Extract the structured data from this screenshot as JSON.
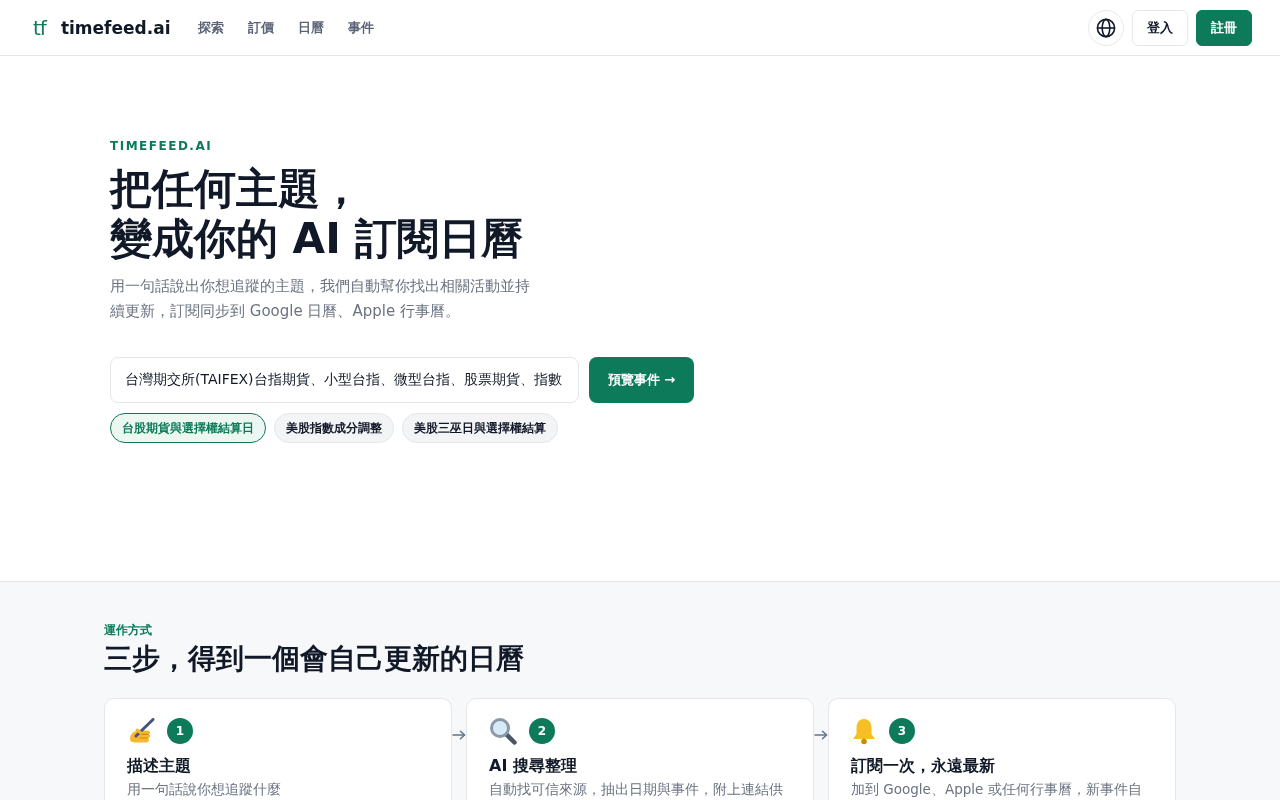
{
  "nav": {
    "logo_mark": "tf",
    "brand": "timefeed.ai",
    "links": [
      {
        "label": "探索"
      },
      {
        "label": "訂價"
      },
      {
        "label": "日曆"
      },
      {
        "label": "事件"
      }
    ],
    "login": "登入",
    "signup": "註冊"
  },
  "hero": {
    "eyebrow": "TIMEFEED.AI",
    "headline_lines": [
      "把任何主題，",
      "變成你的 AI 訂閱日曆"
    ],
    "subtitle": "用一句話說出你想追蹤的主題，我們自動幫你找出相關活動並持續更新，訂閱同步到 Google 日曆、Apple 行事曆。",
    "search": {
      "value": "台灣期交所(TAIFEX)台指期貨、小型台指、微型台指、股票期貨、指數"
    },
    "preview_button": "預覽事件 →",
    "chips": [
      {
        "label": "台股期貨與選擇權結算日",
        "selected": true
      },
      {
        "label": "美股指數成分調整",
        "selected": false
      },
      {
        "label": "美股三巫日與選擇權結算",
        "selected": false
      }
    ]
  },
  "how_it_works": {
    "eyebrow": "運作方式",
    "title": "三步，得到一個會自己更新的日曆",
    "steps": [
      {
        "number": "1",
        "title": "描述主題",
        "description": "用一句話說你想追蹤什麼"
      },
      {
        "number": "2",
        "title": "AI 搜尋整理",
        "description": "自動找可信來源，抽出日期與事件，附上連結供"
      },
      {
        "number": "3",
        "title": "訂閱一次，永遠最新",
        "description": "加到 Google、Apple 或任何行事曆，新事件自"
      }
    ]
  }
}
